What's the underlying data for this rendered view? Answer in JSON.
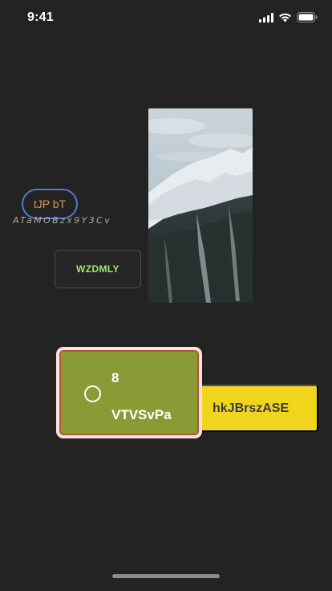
{
  "status_bar": {
    "time": "9:41",
    "icons": [
      "cellular-signal-icon",
      "wifi-icon",
      "battery-icon"
    ]
  },
  "pill_button": {
    "label": "tJP bT"
  },
  "caption": {
    "text": "ATaMOBzx9Y3Cv"
  },
  "outline_button": {
    "label": "WZDMLY"
  },
  "photo": {
    "subject": "snowy mountain slope with pine forest"
  },
  "card": {
    "count": "8",
    "label": "VTVSvPa",
    "selected": false
  },
  "yellow_button": {
    "label": "hkJBrszASE"
  },
  "colors": {
    "background": "#232323",
    "pill_border": "#4e7ad6",
    "pill_text": "#d99b4d",
    "outline_text": "#9ee86b",
    "card_fill": "#8a9b36",
    "card_outer": "#fbe1e1",
    "card_border": "#b55536",
    "yellow": "#f0d51c"
  }
}
